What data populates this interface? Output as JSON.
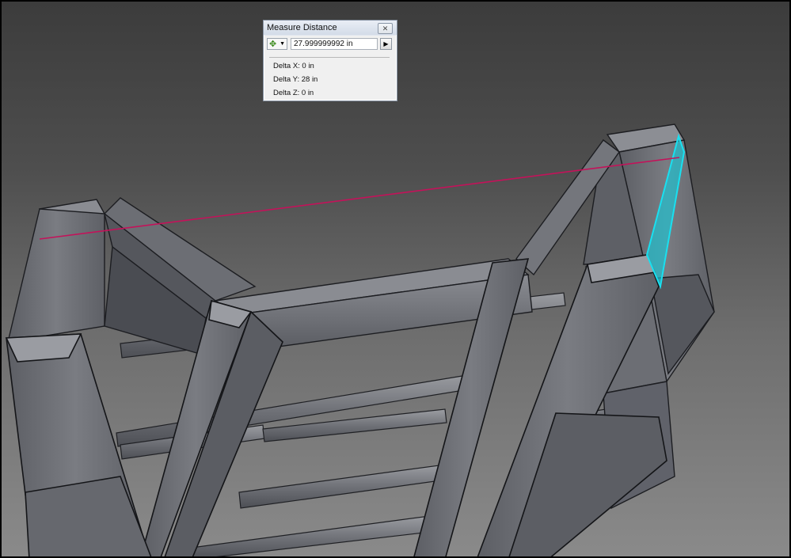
{
  "dialog": {
    "title": "Measure Distance",
    "close_symbol": "✕",
    "tool_icon": "measure-select-icon",
    "tool_caret": "▼",
    "value": "27.999999992 in",
    "arrow_symbol": "▶",
    "deltas": [
      {
        "label": "Delta X: 0 in"
      },
      {
        "label": "Delta Y: 28 in"
      },
      {
        "label": "Delta Z: 0 in"
      }
    ]
  },
  "colors": {
    "measure_line": "#c4125a",
    "highlight_face": "#19c6d6",
    "frame_member": "#74767c"
  }
}
